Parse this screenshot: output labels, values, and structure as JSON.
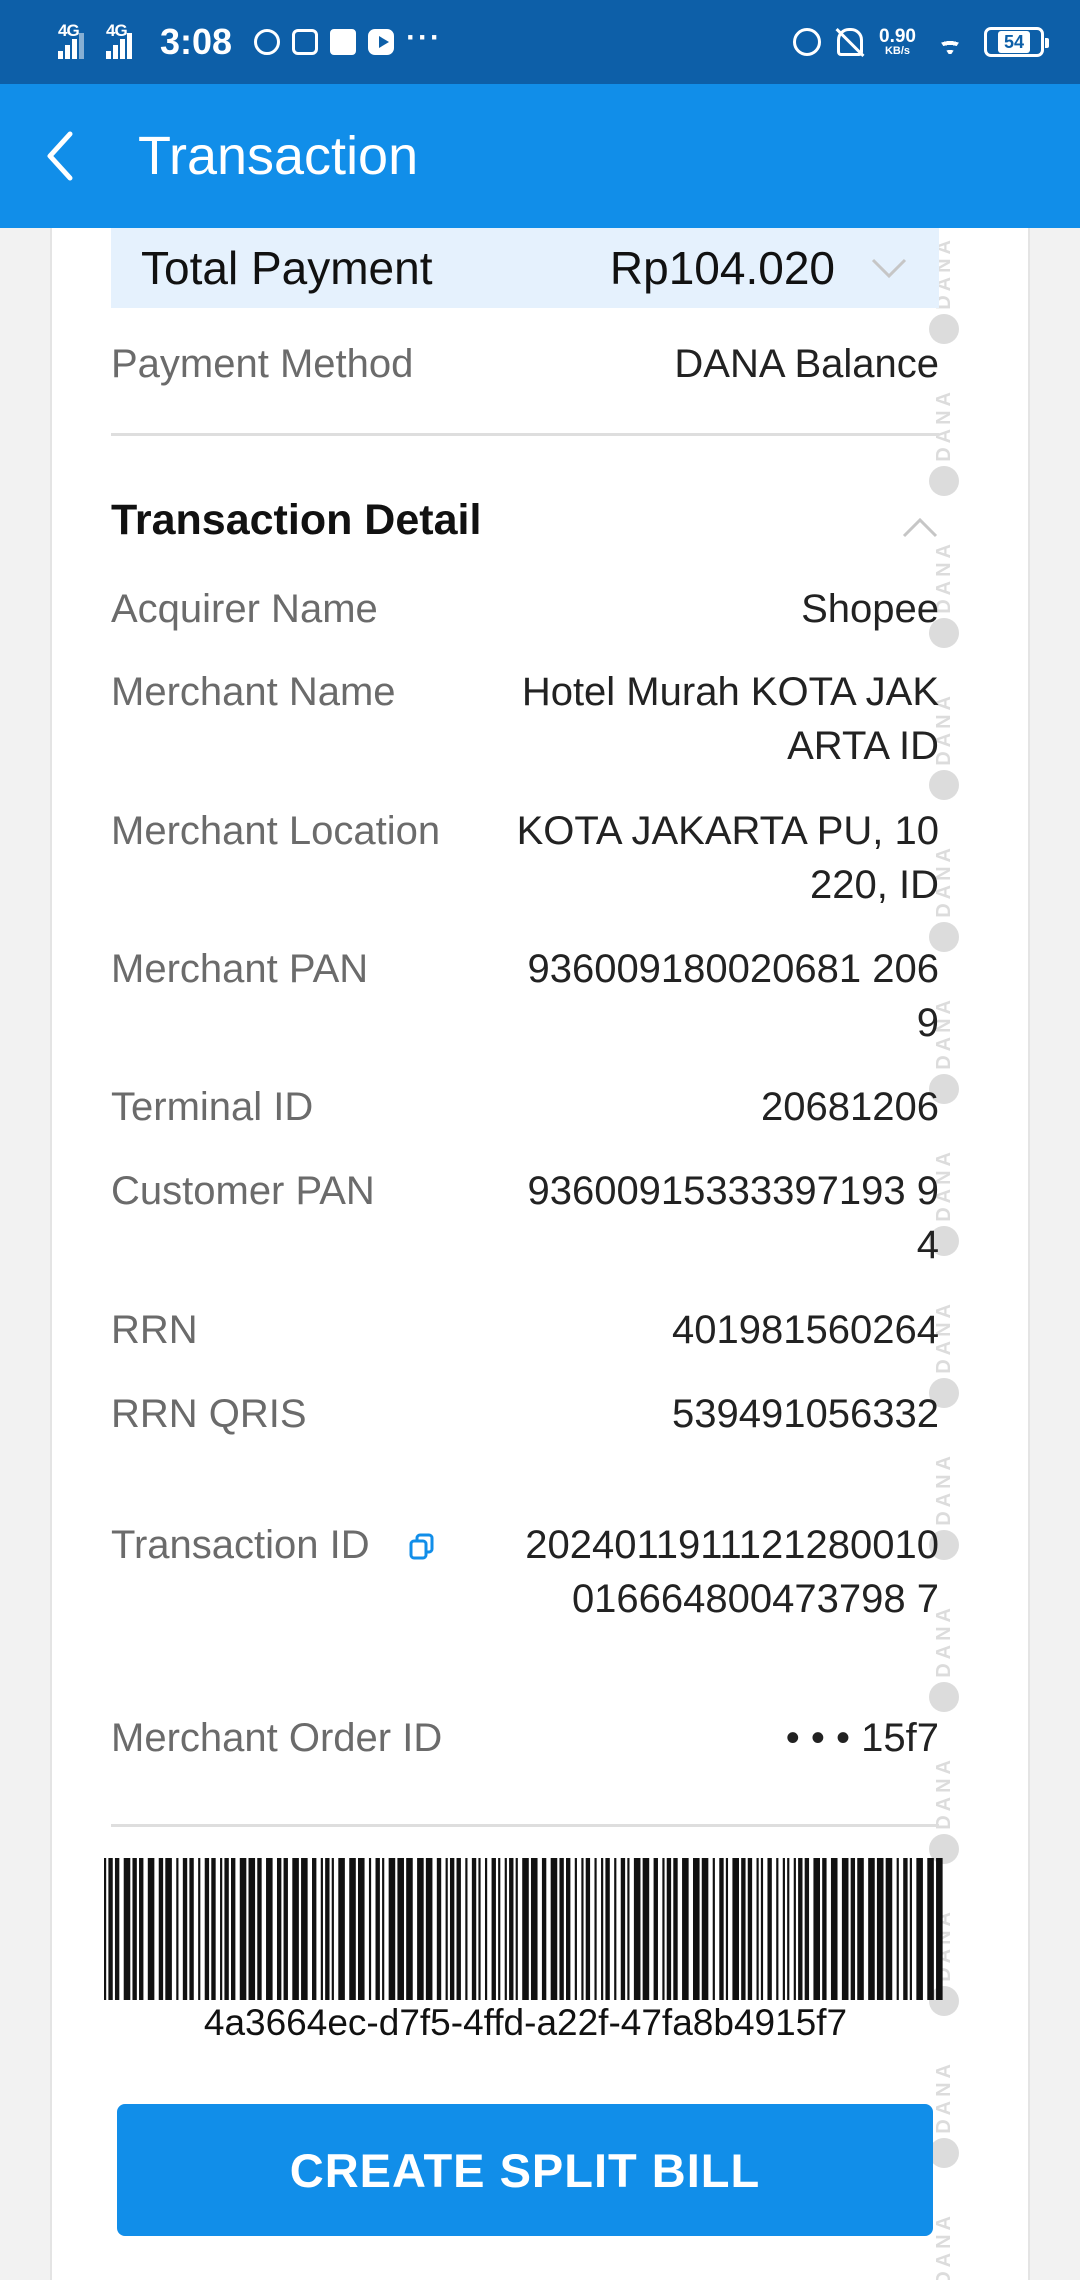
{
  "status_bar": {
    "network1": "4G",
    "network2": "4G",
    "time": "3:08",
    "speed_value": "0.90",
    "speed_unit": "KB/s",
    "battery": "54"
  },
  "app_bar": {
    "title": "Transaction"
  },
  "summary": {
    "total_label": "Total Payment",
    "total_amount": "Rp104.020",
    "payment_method_label": "Payment Method",
    "payment_method_value": "DANA Balance"
  },
  "detail": {
    "title": "Transaction Detail",
    "rows": [
      {
        "label": "Acquirer Name",
        "value": "Shopee"
      },
      {
        "label": "Merchant Name",
        "value": "Hotel Murah KOTA JAKARTA ID"
      },
      {
        "label": "Merchant Location",
        "value": "KOTA JAKARTA PU, 10220, ID"
      },
      {
        "label": "Merchant PAN",
        "value": "936009180020681 2069"
      },
      {
        "label": "Terminal ID",
        "value": "20681206"
      },
      {
        "label": "Customer PAN",
        "value": "93600915333397193 94"
      },
      {
        "label": "RRN",
        "value": "401981560264"
      },
      {
        "label": "RRN QRIS",
        "value": "539491056332"
      },
      {
        "label": "Transaction ID",
        "value": "2024011911121280010016664800473798 7"
      },
      {
        "label": "Merchant Order ID",
        "value": "• • • 15f7"
      }
    ]
  },
  "barcode": {
    "text": "4a3664ec-d7f5-4ffd-a22f-47fa8b4915f7"
  },
  "actions": {
    "split_bill": "CREATE SPLIT BILL"
  },
  "watermark": {
    "text": "DANA"
  },
  "colors": {
    "status_bar": "#0d5fa8",
    "app_bar": "#118ee9",
    "button": "#118ee9",
    "total_bg": "#e5f1fd"
  }
}
